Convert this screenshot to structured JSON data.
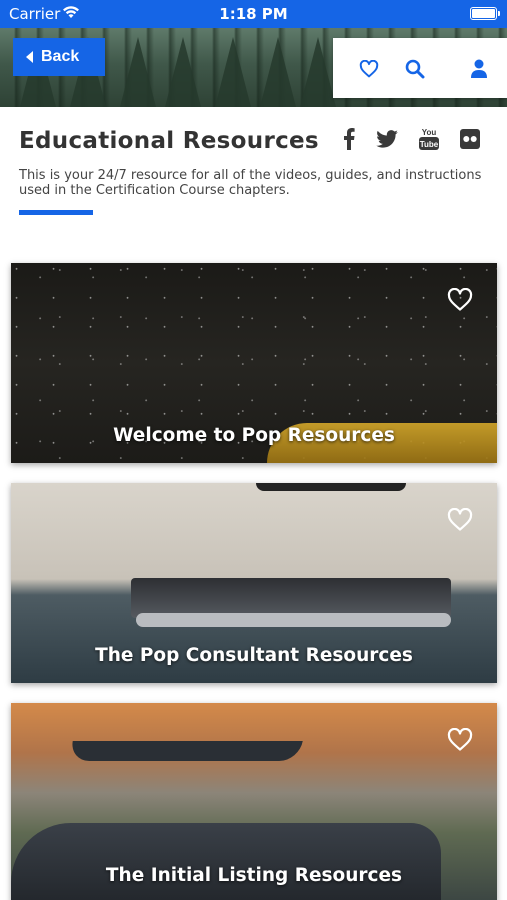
{
  "status_bar": {
    "carrier": "Carrier",
    "time": "1:18 PM"
  },
  "header": {
    "back_label": "Back",
    "icons": [
      "heart-icon",
      "search-icon",
      "user-icon"
    ]
  },
  "intro": {
    "title": "Educational Resources",
    "description": "This is your 24/7 resource for all of the videos, guides, and instructions used in the Certification Course chapters.",
    "social_icons": [
      "facebook-icon",
      "twitter-icon",
      "youtube-icon",
      "flickr-icon"
    ],
    "accent_color": "#1565e6"
  },
  "cards": [
    {
      "title": "Welcome to Pop Resources"
    },
    {
      "title": "The Pop Consultant Resources"
    },
    {
      "title": "The Initial Listing Resources"
    }
  ]
}
